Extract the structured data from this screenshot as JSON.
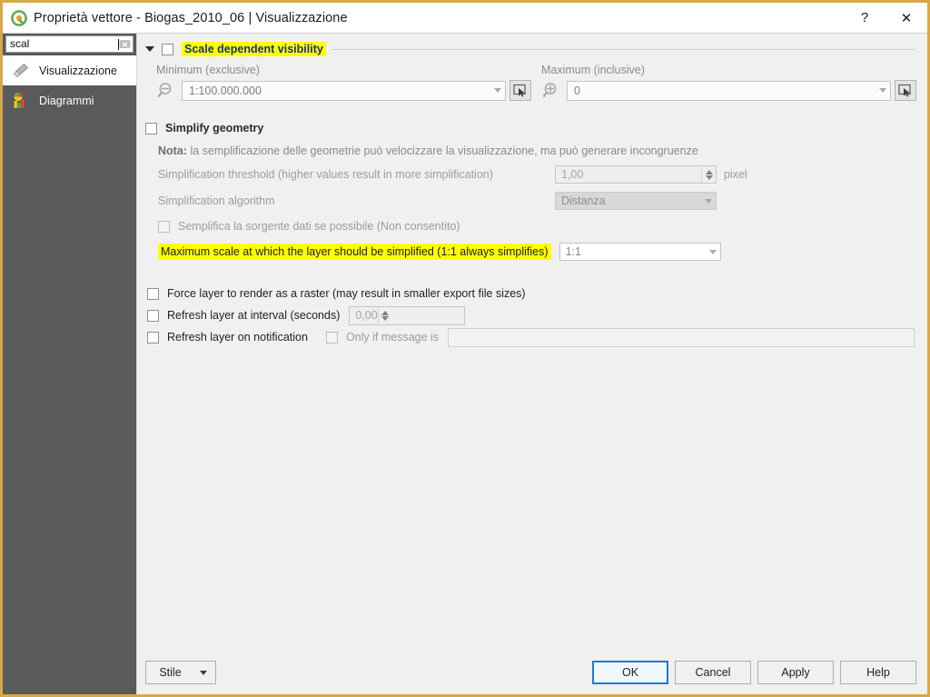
{
  "window": {
    "title": "Proprietà vettore - Biogas_2010_06 | Visualizzazione",
    "logo_icon": "qgis-logo-icon",
    "help_button": "?",
    "close_button": "✕",
    "accent_border": "#d7a84a"
  },
  "sidebar": {
    "search": {
      "value": "scal",
      "placeholder": "",
      "clear_icon": "clear-icon"
    },
    "items": [
      {
        "label": "Visualizzazione",
        "icon": "paintbrush-icon",
        "active": true
      },
      {
        "label": "Diagrammi",
        "icon": "bar-chart-icon",
        "active": false
      }
    ]
  },
  "main": {
    "scale_visibility": {
      "title": "Scale dependent visibility",
      "checked": false,
      "expanded": true,
      "highlight_color": "#ffff00",
      "title_color": "#1a2e8a",
      "minimum": {
        "label": "Minimum (exclusive)",
        "value": "1:100.000.000",
        "icon": "zoom-out-icon",
        "picker_icon": "set-to-canvas-scale-icon"
      },
      "maximum": {
        "label": "Maximum (inclusive)",
        "value": "0",
        "icon": "zoom-in-icon",
        "picker_icon": "set-to-canvas-scale-icon"
      }
    },
    "simplify": {
      "title": "Simplify geometry",
      "checked": false,
      "note_prefix": "Nota:",
      "note_text": "la semplificazione delle geometrie può velocizzare la visualizzazione, ma può generare incongruenze",
      "threshold": {
        "label": "Simplification threshold (higher values result in more simplification)",
        "value": "1,00",
        "unit": "pixel"
      },
      "algorithm": {
        "label": "Simplification algorithm",
        "value": "Distanza"
      },
      "provider_simplify": {
        "label": "Semplifica la sorgente dati se possibile (Non consentito)",
        "checked": false
      },
      "max_scale": {
        "label": "Maximum scale at which the layer should be simplified (1:1 always simplifies)",
        "value": "1:1",
        "highlighted": true
      }
    },
    "options": [
      {
        "label": "Force layer to render as a raster (may result in smaller export file sizes)",
        "checked": false
      },
      {
        "label": "Refresh layer at interval (seconds)",
        "checked": false,
        "value": "0,00"
      },
      {
        "label": "Refresh layer on notification",
        "checked": false
      }
    ],
    "only_if_message": {
      "label": "Only if message is",
      "checked": false,
      "value": ""
    }
  },
  "buttons": {
    "style": "Stile",
    "ok": "OK",
    "cancel": "Cancel",
    "apply": "Apply",
    "help": "Help"
  }
}
